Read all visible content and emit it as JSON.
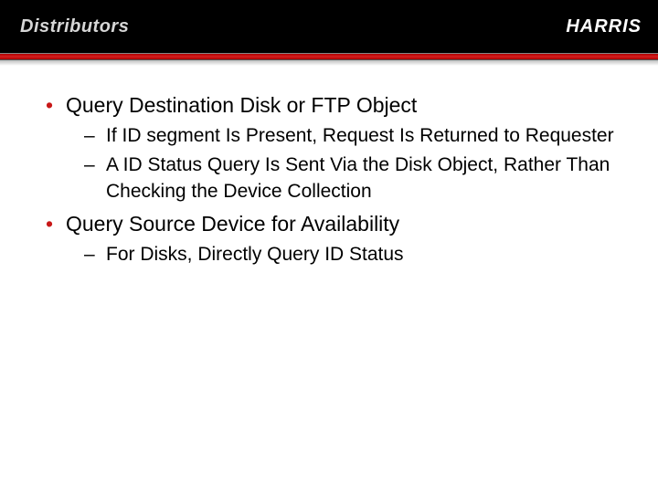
{
  "header": {
    "title": "Distributors",
    "logo": "HARRIS"
  },
  "bullets": [
    {
      "text": "Query Destination Disk or FTP Object",
      "sub": [
        "If ID segment Is Present, Request Is Returned to Requester",
        "A ID Status Query Is Sent Via the Disk Object, Rather Than Checking the Device Collection"
      ]
    },
    {
      "text": "Query Source Device for Availability",
      "sub": [
        "For Disks, Directly Query ID Status"
      ]
    }
  ]
}
